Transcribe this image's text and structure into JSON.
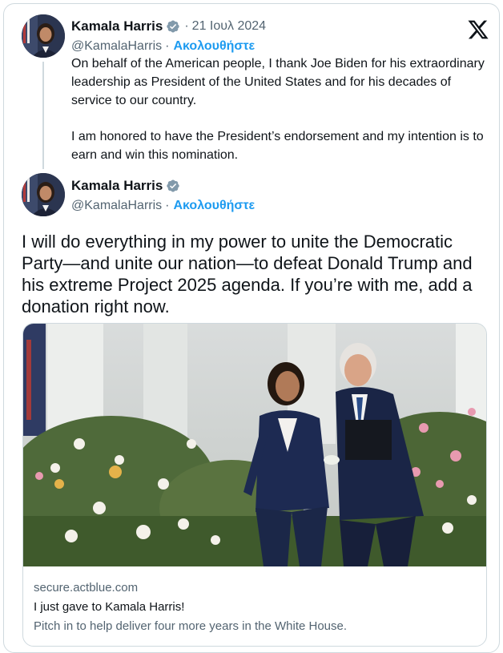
{
  "quoted_tweet": {
    "author": {
      "name": "Kamala Harris",
      "handle": "@KamalaHarris",
      "follow_label": "Ακολουθήστε",
      "verified_icon": "verified-badge-icon",
      "avatar_icon": "avatar-photo"
    },
    "separator": "·",
    "date": "21 Ιουλ 2024",
    "paragraphs": [
      "On behalf of the American people, I thank Joe Biden for his extraordinary leadership as President of the United States and for his decades of service to our country.",
      "I am honored to have the President’s endorsement and my intention is to earn and win this nomination."
    ]
  },
  "main_tweet": {
    "author": {
      "name": "Kamala Harris",
      "handle": "@KamalaHarris",
      "follow_label": "Ακολουθήστε",
      "verified_icon": "verified-badge-icon",
      "avatar_icon": "avatar-photo"
    },
    "text": "I will do everything in my power to unite the Democratic Party—and unite our nation—to defeat Donald Trump and his extreme Project 2025 agenda. If you’re with me, add a donation right now.",
    "link_card": {
      "domain": "secure.actblue.com",
      "title": "I just gave to Kamala Harris!",
      "description": "Pitch in to help deliver four more years in the White House."
    }
  },
  "platform_icon": "x-logo-icon",
  "colors": {
    "accent": "#1d9bf0",
    "text": "#0f1419",
    "secondary_text": "#536471",
    "border": "#cfd9de"
  }
}
